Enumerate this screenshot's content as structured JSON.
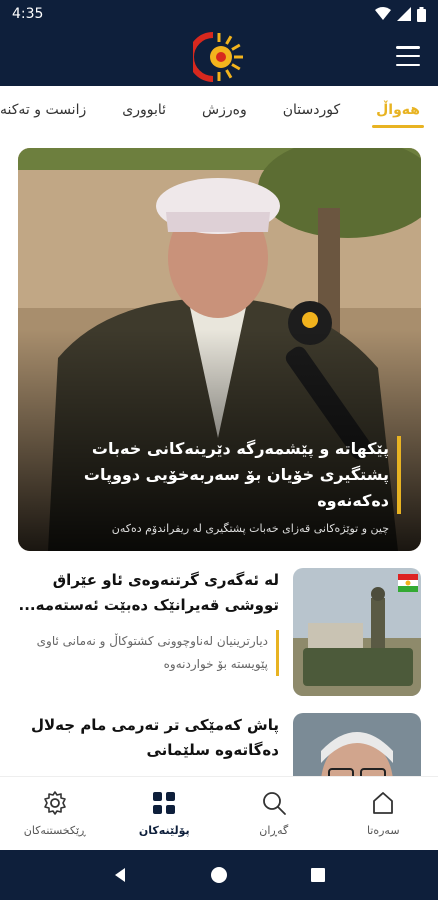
{
  "status_bar": {
    "time": "4:35"
  },
  "app_bar": {
    "logo_icon": "rudaw-sun-logo",
    "menu_icon": "hamburger-icon"
  },
  "tabs": [
    {
      "label": "هەواڵ",
      "active": true
    },
    {
      "label": "کوردستان",
      "active": false
    },
    {
      "label": "وەرزش",
      "active": false
    },
    {
      "label": "ئابووری",
      "active": false
    },
    {
      "label": "زانست و تەکنەلۆژیا",
      "active": false
    }
  ],
  "hero": {
    "title": "پێکهاتە و پێشمەرگە دێرینەکانی خەبات پشتگیری خۆیان بۆ سەربەخۆیی دووپات دەکەنەوە",
    "subtitle": "چین و توێژەکانی قەزای خەبات پشتگیری لە ریفراندۆم دەکەن"
  },
  "articles": [
    {
      "title": "لە ئەگەری گرتنەوەی ئاو عێراق تووشی قەیرانێک دەبێت ئەستەمە...",
      "subtitle": "دیارترینیان لەناوچوونی کشتوکاڵ و نەمانی ئاوی پێویستە بۆ خواردنەوە"
    },
    {
      "title": "پاش کەمێکی تر تەرمی مام جەلال دەگاتەوە سلێمانی",
      "subtitle": ""
    }
  ],
  "bottom_nav": [
    {
      "label": "سەرەتا",
      "icon": "home-icon",
      "active": false
    },
    {
      "label": "گەڕان",
      "icon": "search-icon",
      "active": false
    },
    {
      "label": "پۆلێنەکان",
      "icon": "categories-grid-icon",
      "active": true
    },
    {
      "label": "ڕێکخستنەکان",
      "icon": "gear-icon",
      "active": false
    }
  ],
  "colors": {
    "primary": "#0e1f3b",
    "accent": "#e8b322"
  }
}
